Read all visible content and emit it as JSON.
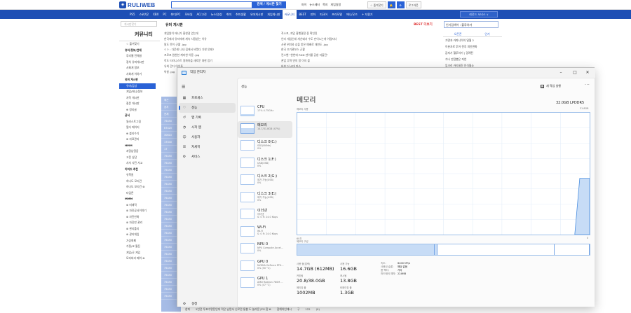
{
  "site": {
    "logo": "RULIWEB",
    "search_button": "검색 / 게시판 찾기",
    "top_links": [
      "마이",
      "뉴스레터",
      "쪽지",
      "게임일정"
    ],
    "top_buttons": [
      "☆ 즐겨찾기",
      "🔔",
      "⚙",
      "로그아웃"
    ],
    "nav": [
      "PS5",
      "스위치2",
      "XBX",
      "PC",
      "모바일",
      "모바일게임",
      "모바일",
      "AC"
    ],
    "nav_items": [
      "PS5",
      "스위치2",
      "XBX",
      "PC",
      "취미/PC",
      "모바일",
      "AC/고전",
      "뉴스/영상",
      "취미",
      "취미생활",
      "유머게시판",
      "게임게시판",
      "커뮤니티",
      "BEST",
      "만화",
      "피규어",
      "프라모델",
      "애니/굿즈",
      "+ 지원기"
    ],
    "nav_active_index": 12,
    "nav_right": "레전드 서비스 ∨",
    "sidebar_search": "게시판찾기",
    "sidebar_title": "커뮤니티",
    "sidebar_items": [
      {
        "label": "☆ 즐겨찾기",
        "type": "normal"
      },
      {
        "label": "유저/정보/연재",
        "type": "head"
      },
      {
        "label": "루리웹 전체글",
        "type": "normal"
      },
      {
        "label": "정치 유머게시판",
        "type": "normal"
      },
      {
        "label": "사회게 정보",
        "type": "normal"
      },
      {
        "label": "사회게 이야기",
        "type": "normal"
      },
      {
        "label": "유머 게시판",
        "type": "head"
      },
      {
        "label": "유머/감상",
        "type": "active"
      },
      {
        "label": "게임/애니/정보",
        "type": "normal"
      },
      {
        "label": "자작 게시판",
        "type": "normal"
      },
      {
        "label": "질문 게시판",
        "type": "normal"
      },
      {
        "label": "⊕ 정리글",
        "type": "normal"
      },
      {
        "label": "공식",
        "type": "head"
      },
      {
        "label": "일러스트그림",
        "type": "normal"
      },
      {
        "label": "필더 메이커",
        "type": "normal"
      },
      {
        "label": "⊕ 블리수기",
        "type": "normal"
      },
      {
        "label": "⊕ 자료관리",
        "type": "normal"
      },
      {
        "label": "HMM",
        "type": "head"
      },
      {
        "label": "과달남얼음",
        "type": "normal"
      },
      {
        "label": "고전 상담",
        "type": "normal"
      },
      {
        "label": "사사 사진 사고",
        "type": "normal"
      },
      {
        "label": "이미즈 추천",
        "type": "head"
      },
      {
        "label": "유학원",
        "type": "normal"
      },
      {
        "label": "하나도 모리건",
        "type": "normal"
      },
      {
        "label": "하나도 모리건 ⊗",
        "type": "normal"
      },
      {
        "label": "타입론",
        "type": "normal"
      },
      {
        "label": "MMM",
        "type": "head"
      },
      {
        "label": "⊗ 미래적",
        "type": "normal"
      },
      {
        "label": "⊗ 자진공사이야기",
        "type": "normal"
      },
      {
        "label": "⊗ 자진만화",
        "type": "normal"
      },
      {
        "label": "⊗ 자진만 관리",
        "type": "normal"
      },
      {
        "label": "⊗ 관리폴리",
        "type": "normal"
      },
      {
        "label": "⊗ 관리게임",
        "type": "normal"
      },
      {
        "label": "가상화폐",
        "type": "normal"
      },
      {
        "label": "가정/교 월진",
        "type": "normal"
      },
      {
        "label": "게임/굿 게임",
        "type": "normal"
      },
      {
        "label": "모티버리 페이 ⊗",
        "type": "normal"
      }
    ],
    "board_title": "유머 게시판",
    "best_label": "BEST 더보기",
    "best_rows": [
      [
        "게임원이 애니가 흥한걸 얻는데",
        "직소포, 게임 흥행결정 중 확인된"
      ],
      [
        "한국에서 유저에게 계속 사랑받는 이유",
        "인터 게임인데 개선돼서 수도 만이노는게 어렵지다"
      ],
      [
        "말도 못이 근황 .jpg",
        "사관 위치와 상을 받은 예배로 재연도 .jpg"
      ],
      [
        "ㅇㅇ : 다운레 나내 집에서 바꿨다 기한 안돼?",
        "한국 조기관보스 근황"
      ],
      [
        "프로포 원한한 케미한 이용 .jpg",
        "컨스헨 \"한번에 RND 덴이를 공창 저출전\""
      ],
      [
        "작도 티라니스트 영화마을 새로운 대한 장기",
        "관업 무역 연의 정 이지 블 "
      ],
      [
        "유희 간다 아이들",
        "바보 더 시대 마스"
      ],
      [
        "박봉 .jpg",
        ""
      ]
    ],
    "row_strip": [
      "최근",
      "공지",
      "전체",
      "75450",
      "67420",
      "30610",
      "17040",
      "17",
      "75450",
      "75450",
      "75450",
      "75450",
      "75450",
      "75450",
      "75450",
      "75450",
      "75450",
      "75450",
      "75450",
      "75450",
      "75450",
      "75450",
      "75450",
      "75450",
      "75450",
      "75450",
      "75450",
      "75450",
      "75450"
    ],
    "bottom_row": [
      "창퍼",
      "5년전 투표수명전인데 적은 남면서 신로전 통할 도 놀라운 JPG 함 ⊕",
      "참해하인에시",
      "구",
      "122",
      "(0)"
    ],
    "right_search": "인기검색어 : 블루아카",
    "right_tabs": [
      "오픈존",
      "인기"
    ],
    "right_items": [
      "가면과 카파니이의 밀월 2",
      "이분자로 투어 전후 피인변화",
      "갑지기 혈투하기 | 경례된",
      "가나 만점별은 지연",
      "임크리 카리네진 인식될쇼"
    ]
  },
  "taskmgr": {
    "title": "작업 관리자",
    "nav_items": [
      {
        "icon": "▦",
        "label": "프로세스",
        "name": "processes"
      },
      {
        "icon": "♡",
        "label": "성능",
        "name": "performance"
      },
      {
        "icon": "↺",
        "label": "앱 기록",
        "name": "app-history"
      },
      {
        "icon": "◔",
        "label": "시작 앱",
        "name": "startup-apps"
      },
      {
        "icon": "☺",
        "label": "사용자",
        "name": "users"
      },
      {
        "icon": "☰",
        "label": "자세히",
        "name": "details"
      },
      {
        "icon": "⚙",
        "label": "서비스",
        "name": "services"
      }
    ],
    "nav_active_index": 1,
    "settings_label": "설정",
    "section_label": "성능",
    "run_task": "새 작업 실행",
    "resources": [
      {
        "name": "CPU",
        "sub": [
          "17% 4.75GHz"
        ],
        "fill": 0.17
      },
      {
        "name": "메모리",
        "sub": [
          "14.7/31.8GB (47%)"
        ],
        "fill": 0.47
      },
      {
        "name": "디스크 0(C:)",
        "sub": [
          "SSD(NVMe)",
          "0%"
        ],
        "fill": 0.0
      },
      {
        "name": "디스크 1(F:)",
        "sub": [
          "USB(USB)",
          "0%"
        ],
        "fill": 0.0
      },
      {
        "name": "디스크 2(G:)",
        "sub": [
          "제거 가능(USB)",
          "0%"
        ],
        "fill": 0.0
      },
      {
        "name": "디스크 3(E:)",
        "sub": [
          "제거 가능(USB)",
          "0%"
        ],
        "fill": 0.0
      },
      {
        "name": "이더넷",
        "sub": [
          "이더넷",
          "S: 0 R: 24.0 Kbps"
        ],
        "fill": 0.0
      },
      {
        "name": "Wi-Fi",
        "sub": [
          "Wi-Fi",
          "S: 0 R: 24.0 Kbps"
        ],
        "fill": 0.0
      },
      {
        "name": "NPU 0",
        "sub": [
          "NPU Compute Accel...",
          "0%"
        ],
        "fill": 0.0
      },
      {
        "name": "GPU 0",
        "sub": [
          "NVIDIA GeForce RTX...",
          "0% (50 °C)"
        ],
        "fill": 0.0
      },
      {
        "name": "GPU 1",
        "sub": [
          "AMD Radeon 780M ...",
          "0% (47 °C)"
        ],
        "fill": 0.0
      }
    ],
    "active_resource": 1,
    "mem_title": "메모리",
    "mem_total": "32.0GB LPDDR5",
    "usage_label": "메모리 사용",
    "graph_max": "31.8GB",
    "graph_time": "60초",
    "graph_zero": "0",
    "comp_label": "메모리 구성",
    "usage_series": [
      0,
      0,
      0,
      0,
      0,
      0,
      0,
      0,
      0,
      0,
      0,
      0,
      0,
      0,
      0,
      0,
      0,
      0,
      0,
      0,
      0,
      0,
      0,
      0,
      0,
      0,
      0,
      0,
      0,
      0,
      0,
      0,
      0,
      0,
      0,
      0,
      0,
      0,
      0,
      0,
      0,
      0,
      0,
      0,
      0,
      0,
      0,
      0,
      0,
      0,
      0,
      0,
      0,
      0,
      0,
      0,
      0,
      14.7,
      14.7,
      14.7
    ],
    "usage_max": 31.8,
    "composition": [
      {
        "label": "사용 중",
        "fraction": 0.47
      },
      {
        "label": "수정됨",
        "fraction": 0.01
      },
      {
        "label": "대기",
        "fraction": 0.4
      },
      {
        "label": "사용 가능",
        "fraction": 0.12
      }
    ],
    "stats": {
      "in_use_label": "사용 중(압축)",
      "in_use": "14.7GB (612MB)",
      "available_label": "사용 가능",
      "available": "16.6GB",
      "committed_label": "커밋됨",
      "committed": "20.8/38.0GB",
      "cached_label": "캐시됨",
      "cached": "13.8GB",
      "paged_label": "페이징 풀",
      "paged": "1002MB",
      "nonpaged_label": "비페이징 풀",
      "nonpaged": "1.3GB"
    },
    "kv": [
      {
        "k": "속도:",
        "v": "6400 MT/s"
      },
      {
        "k": "사용된 슬롯:",
        "v": "해당 없음"
      },
      {
        "k": "폼 팩터:",
        "v": "기타"
      },
      {
        "k": "하드웨어 예약:",
        "v": "224MB"
      }
    ]
  }
}
